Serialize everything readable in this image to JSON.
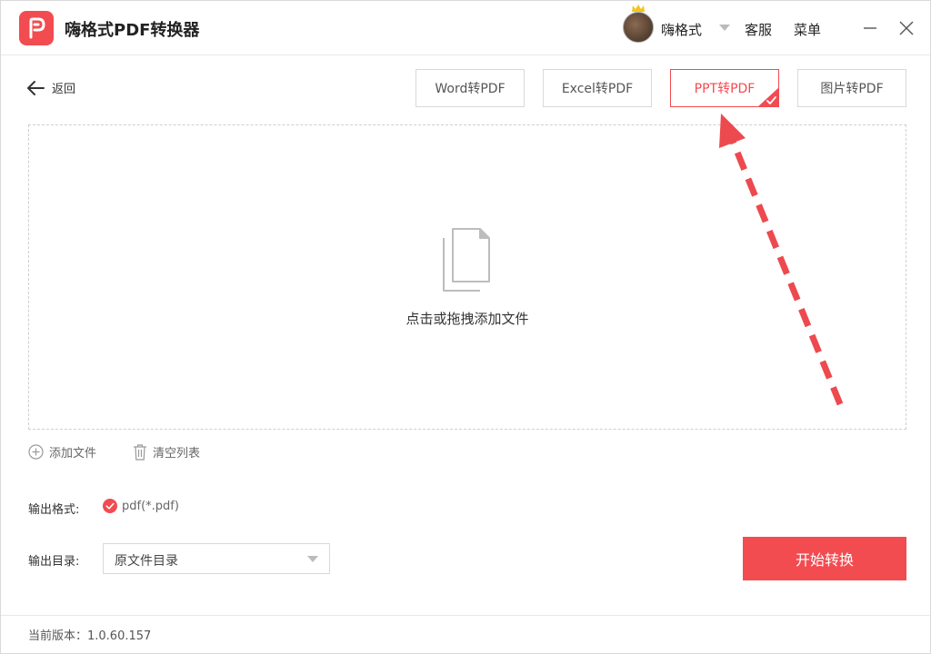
{
  "app": {
    "title": "嗨格式PDF转换器"
  },
  "header": {
    "username": "嗨格式",
    "service": "客服",
    "menu": "菜单"
  },
  "nav": {
    "back_label": "返回"
  },
  "tabs": [
    {
      "label": "Word转PDF",
      "active": false
    },
    {
      "label": "Excel转PDF",
      "active": false
    },
    {
      "label": "PPT转PDF",
      "active": true
    },
    {
      "label": "图片转PDF",
      "active": false
    }
  ],
  "dropzone": {
    "text": "点击或拖拽添加文件"
  },
  "file_actions": {
    "add": "添加文件",
    "clear": "清空列表"
  },
  "output": {
    "format_label": "输出格式:",
    "format_value": "pdf(*.pdf)",
    "dir_label": "输出目录:",
    "dir_value": "原文件目录"
  },
  "start_button": "开始转换",
  "footer": {
    "version": "当前版本：1.0.60.157"
  },
  "colors": {
    "accent": "#f24b50",
    "border": "#d9d9d9"
  }
}
